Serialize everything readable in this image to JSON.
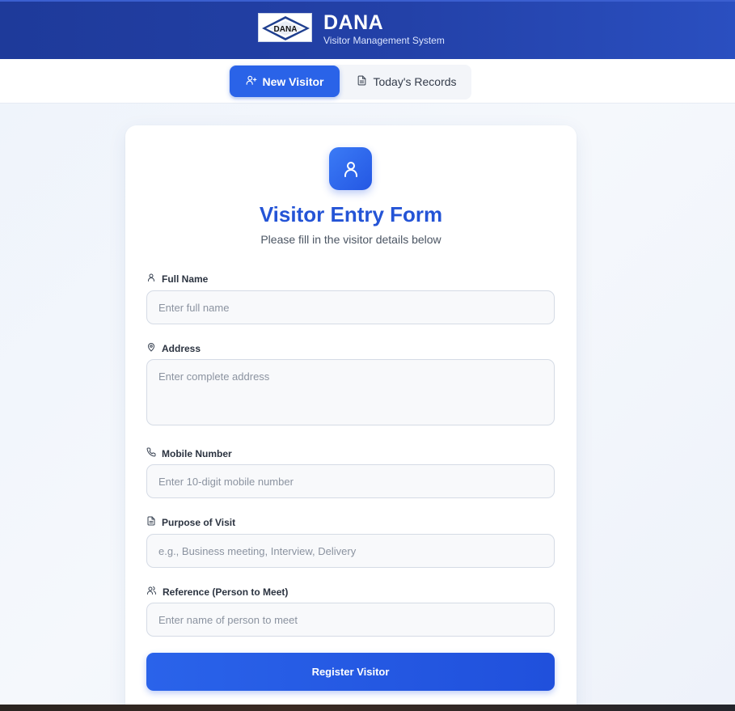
{
  "header": {
    "logo_text": "DANA",
    "title": "DANA",
    "subtitle": "Visitor Management System",
    "bg_color": "#2341a8"
  },
  "tabs": [
    {
      "label": "New Visitor",
      "icon": "user-plus-icon",
      "active": true
    },
    {
      "label": "Today's Records",
      "icon": "document-icon",
      "active": false
    }
  ],
  "form": {
    "icon": "user-icon",
    "title": "Visitor Entry Form",
    "subtitle": "Please fill in the visitor details below",
    "fields": [
      {
        "label": "Full Name",
        "icon": "user-icon",
        "placeholder": "Enter full name",
        "value": ""
      },
      {
        "label": "Address",
        "icon": "map-pin-icon",
        "placeholder": "Enter complete address",
        "value": ""
      },
      {
        "label": "Mobile Number",
        "icon": "phone-icon",
        "placeholder": "Enter 10-digit mobile number",
        "value": ""
      },
      {
        "label": "Purpose of Visit",
        "icon": "document-icon",
        "placeholder": "e.g., Business meeting, Interview, Delivery",
        "value": ""
      },
      {
        "label": "Reference (Person to Meet)",
        "icon": "users-icon",
        "placeholder": "Enter name of person to meet",
        "value": ""
      }
    ],
    "submit_label": "Register Visitor"
  },
  "colors": {
    "accent": "#2a63e8",
    "title": "#2454d6"
  }
}
